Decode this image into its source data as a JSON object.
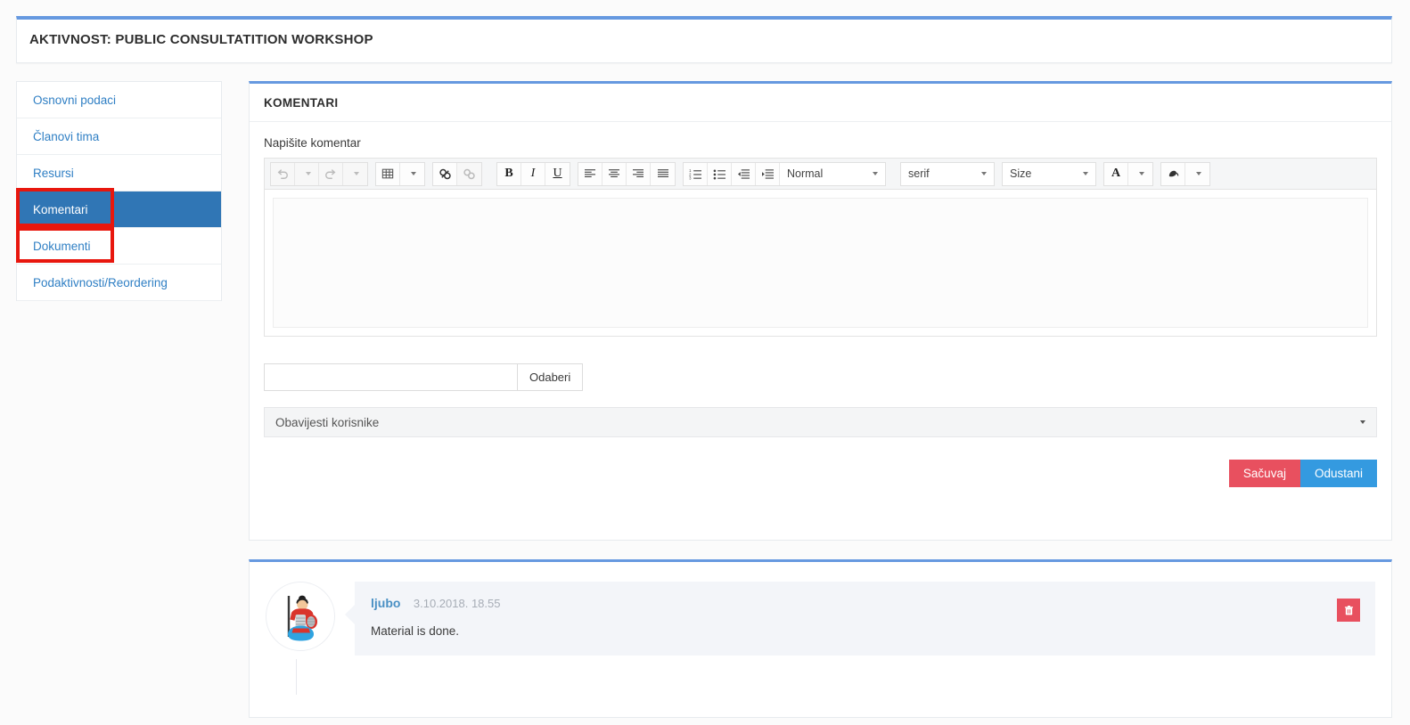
{
  "header": {
    "title": "AKTIVNOST: PUBLIC CONSULTATITION WORKSHOP"
  },
  "sidebar": {
    "items": [
      {
        "label": "Osnovni podaci",
        "active": false
      },
      {
        "label": "Članovi tima",
        "active": false
      },
      {
        "label": "Resursi",
        "active": false
      },
      {
        "label": "Komentari",
        "active": true
      },
      {
        "label": "Dokumenti",
        "active": false
      },
      {
        "label": "Podaktivnosti/Reordering",
        "active": false
      }
    ]
  },
  "main": {
    "panel_title": "KOMENTARI",
    "comment_label": "Napišite komentar",
    "editor": {
      "content": "",
      "toolbar": {
        "undo_icon": "undo-icon",
        "redo_icon": "redo-icon",
        "table_icon": "table-icon",
        "link_icon": "link-icon",
        "unlink_icon": "unlink-icon",
        "bold_label": "B",
        "italic_label": "I",
        "underline_label": "U",
        "align_left_icon": "align-left-icon",
        "align_center_icon": "align-center-icon",
        "align_right_icon": "align-right-icon",
        "align_justify_icon": "align-justify-icon",
        "ordered_list_icon": "ordered-list-icon",
        "unordered_list_icon": "unordered-list-icon",
        "outdent_icon": "outdent-icon",
        "indent_icon": "indent-icon",
        "format_value": "Normal",
        "font_value": "serif",
        "size_value": "Size",
        "text_color_label": "A",
        "background_color_icon": "highlighter-icon"
      }
    },
    "file": {
      "value": "",
      "browse_label": "Odaberi"
    },
    "notify": {
      "value": "Obavijesti korisnike"
    },
    "buttons": {
      "save_label": "Sačuvaj",
      "cancel_label": "Odustani"
    }
  },
  "comments": [
    {
      "author": "ljubo",
      "date": "3.10.2018. 18.55",
      "text": "Material is done.",
      "avatar_name": "samurai-avatar",
      "delete_icon": "trash-icon"
    }
  ],
  "annotations": [
    {
      "name": "highlight-komentari",
      "color": "#e8170e"
    },
    {
      "name": "highlight-dokumenti",
      "color": "#e8170e"
    }
  ],
  "colors": {
    "accent_blue": "#6699e0",
    "active_item_blue": "#3076b5",
    "link_blue": "#2f7fc4",
    "save_red": "#e8505f",
    "cancel_blue": "#349ae0",
    "annotation_red": "#e8170e"
  }
}
